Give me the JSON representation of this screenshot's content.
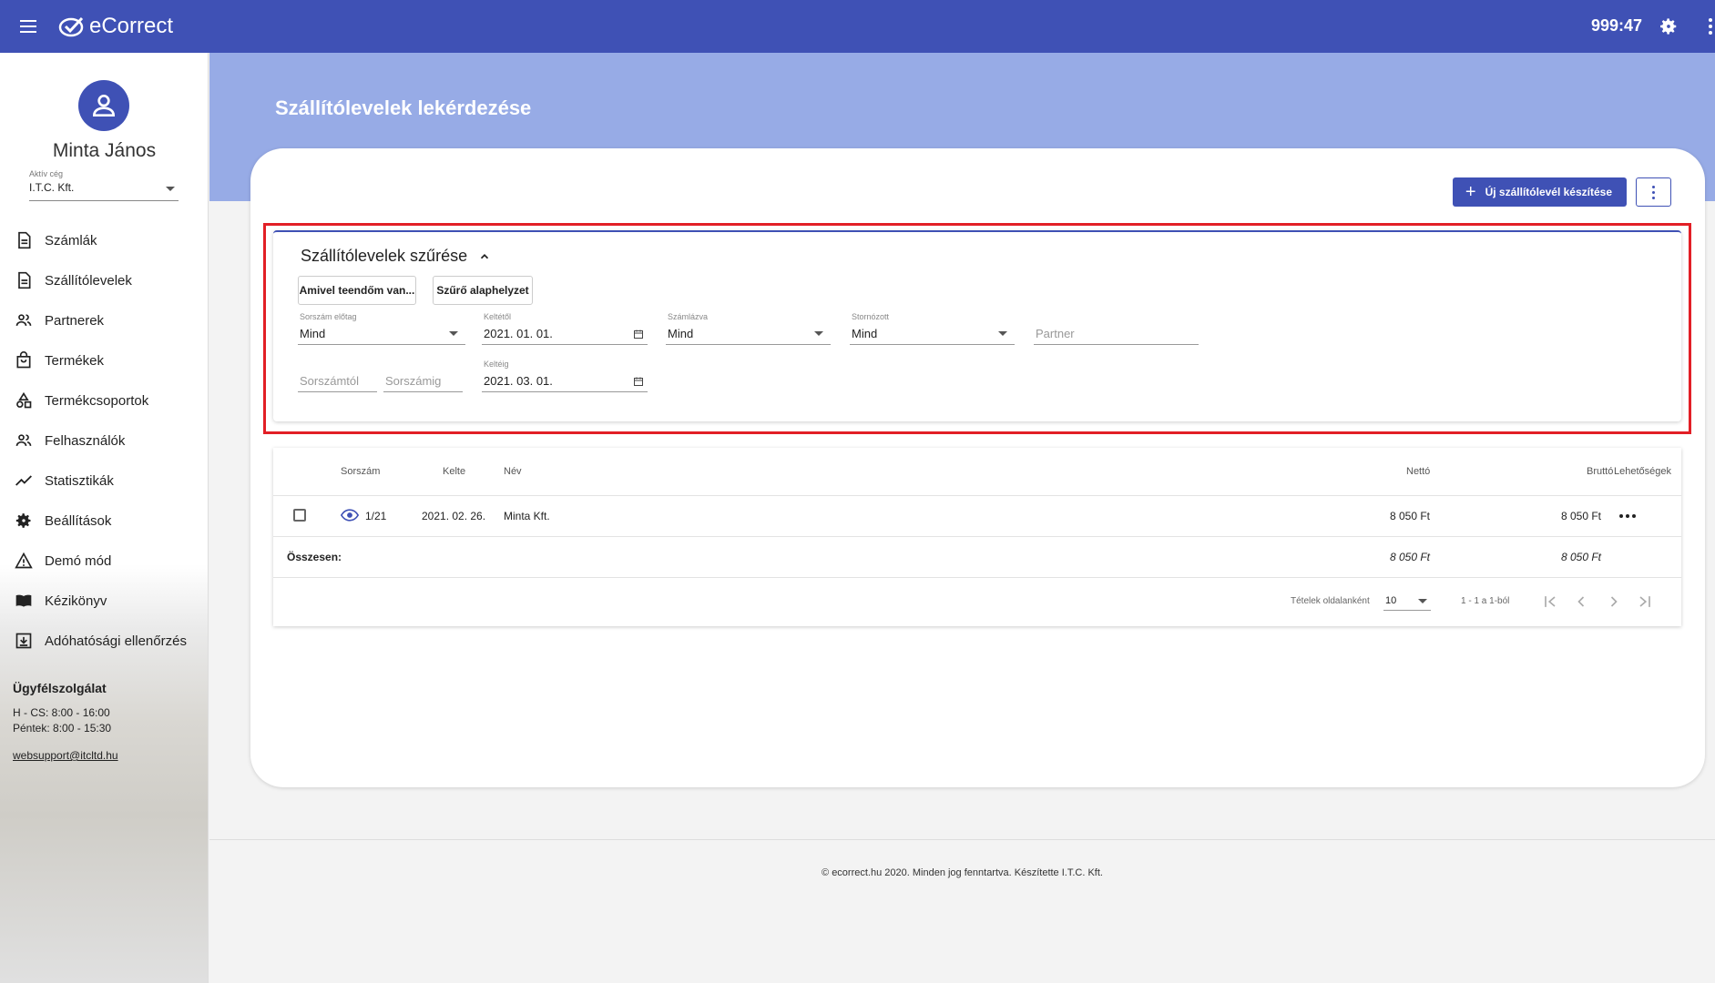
{
  "app": {
    "name": "eCorrect",
    "timer": "999:47"
  },
  "sidebar": {
    "user_name": "Minta János",
    "company_label": "Aktív cég",
    "company_value": "I.T.C. Kft.",
    "items": [
      {
        "label": "Számlák",
        "icon": "document-icon"
      },
      {
        "label": "Szállítólevelek",
        "icon": "document-icon"
      },
      {
        "label": "Partnerek",
        "icon": "people-icon"
      },
      {
        "label": "Termékek",
        "icon": "bag-icon"
      },
      {
        "label": "Termékcsoportok",
        "icon": "shapes-icon"
      },
      {
        "label": "Felhasználók",
        "icon": "people-icon"
      },
      {
        "label": "Statisztikák",
        "icon": "trending-icon"
      },
      {
        "label": "Beállítások",
        "icon": "gear-icon"
      },
      {
        "label": "Demó mód",
        "icon": "warning-icon"
      },
      {
        "label": "Kézikönyv",
        "icon": "book-icon"
      },
      {
        "label": "Adóhatósági ellenőrzés",
        "icon": "download-box-icon"
      }
    ],
    "support": {
      "title": "Ügyfélszolgálat",
      "hours1": "H - CS: 8:00 - 16:00",
      "hours2": "Péntek: 8:00 - 15:30",
      "email": "websupport@itcltd.hu"
    }
  },
  "page": {
    "title": "Szállítólevelek lekérdezése",
    "new_button": "Új szállítólevél készítése"
  },
  "filter": {
    "title": "Szállítólevelek szűrése",
    "btn_todo": "Amivel teendőm van...",
    "btn_reset": "Szűrő alaphelyzet",
    "prefix_label": "Sorszám előtag",
    "prefix_value": "Mind",
    "date_from_label": "Keltétől",
    "date_from_value": "2021. 01. 01.",
    "invoiced_label": "Számlázva",
    "invoiced_value": "Mind",
    "cancelled_label": "Stornózott",
    "cancelled_value": "Mind",
    "partner_placeholder": "Partner",
    "serial_from_placeholder": "Sorszámtól",
    "serial_to_placeholder": "Sorszámig",
    "date_to_label": "Keltéig",
    "date_to_value": "2021. 03. 01."
  },
  "table": {
    "headers": {
      "serial": "Sorszám",
      "date": "Kelte",
      "name": "Név",
      "net": "Nettó",
      "gross": "Bruttó",
      "options": "Lehetőségek"
    },
    "rows": [
      {
        "serial": "1/21",
        "date": "2021. 02. 26.",
        "name": "Minta Kft.",
        "net": "8 050 Ft",
        "gross": "8 050 Ft"
      }
    ],
    "total_label": "Összesen:",
    "total_net": "8 050 Ft",
    "total_gross": "8 050 Ft",
    "per_page_label": "Tételek oldalanként",
    "per_page_value": "10",
    "range": "1 - 1 a 1-ból"
  },
  "footer": {
    "text": "© ecorrect.hu 2020. Minden jog fenntartva. Készítette I.T.C. Kft."
  },
  "colors": {
    "primary": "#3f51b5",
    "banner": "#97abe6",
    "highlight": "#e21f26"
  }
}
